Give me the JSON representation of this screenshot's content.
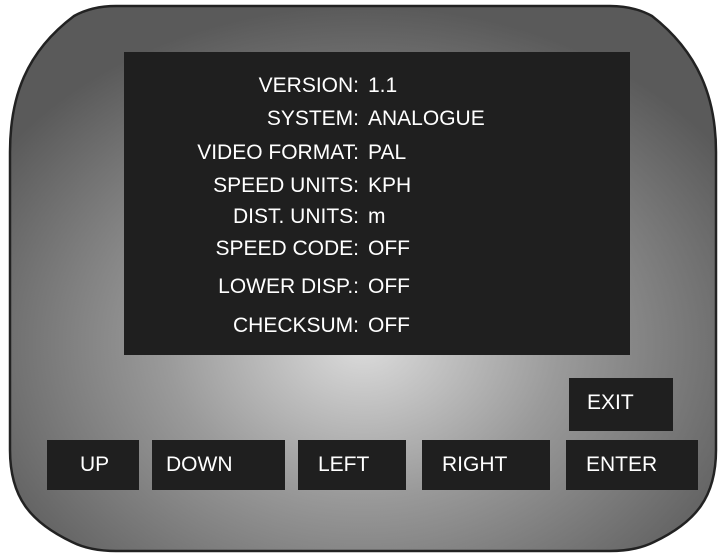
{
  "settings": [
    {
      "label": "VERSION:",
      "value": "1.1"
    },
    {
      "label": "SYSTEM:",
      "value": "ANALOGUE"
    },
    {
      "label": "VIDEO FORMAT:",
      "value": "PAL"
    },
    {
      "label": "SPEED UNITS:",
      "value": "KPH"
    },
    {
      "label": "DIST. UNITS:",
      "value": "m"
    },
    {
      "label": "SPEED CODE:",
      "value": "OFF"
    },
    {
      "label": "LOWER DISP.:",
      "value": "OFF"
    },
    {
      "label": "CHECKSUM:",
      "value": "OFF"
    }
  ],
  "buttons": {
    "exit": "EXIT",
    "up": "UP",
    "down": "DOWN",
    "left": "LEFT",
    "right": "RIGHT",
    "enter": "ENTER"
  },
  "colors": {
    "screen": "#1f1f1f",
    "text": "#ffffff",
    "bezel_outline": "#222222"
  }
}
